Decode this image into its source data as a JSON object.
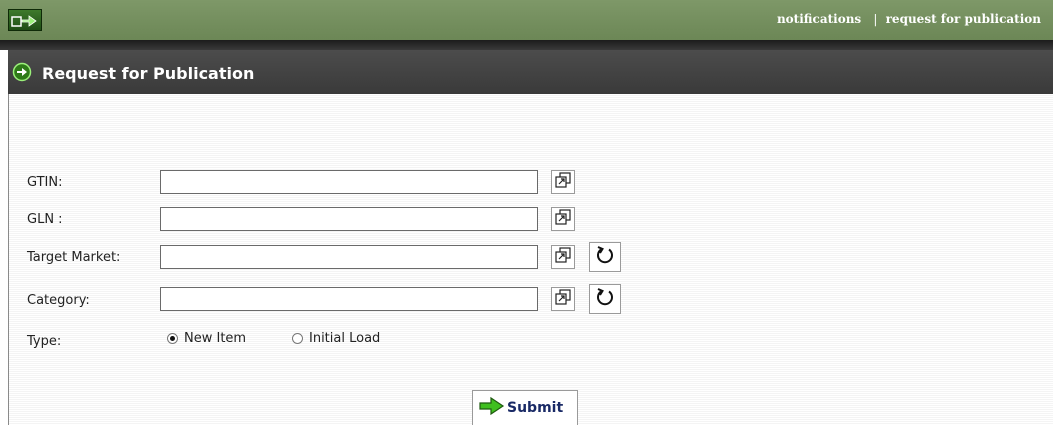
{
  "header": {
    "links": {
      "notifications": "notifications",
      "separator": "|",
      "request_for_publication": "request for publication"
    },
    "logo_icon": "app-logo-icon"
  },
  "title": {
    "icon": "circle-arrow-right-icon",
    "text": "Request for Publication"
  },
  "form": {
    "gtin": {
      "label": "GTIN:",
      "value": "",
      "lookup_icon": "lookup-icon"
    },
    "gln": {
      "label": "GLN :",
      "value": "",
      "lookup_icon": "lookup-icon"
    },
    "target_market": {
      "label": "Target Market:",
      "value": "",
      "lookup_icon": "lookup-icon",
      "reset_icon": "reset-icon"
    },
    "category": {
      "label": "Category:",
      "value": "",
      "lookup_icon": "lookup-icon",
      "reset_icon": "reset-icon"
    },
    "type": {
      "label": "Type:",
      "options": [
        {
          "label": "New Item",
          "checked": true
        },
        {
          "label": "Initial Load",
          "checked": false
        }
      ]
    },
    "submit": {
      "label": "Submit",
      "icon": "arrow-right-icon"
    }
  },
  "colors": {
    "header_green": "#6c8756",
    "titlebar": "#444444",
    "submit_text": "#1a2a66",
    "accent_green": "#3fbf1f"
  }
}
